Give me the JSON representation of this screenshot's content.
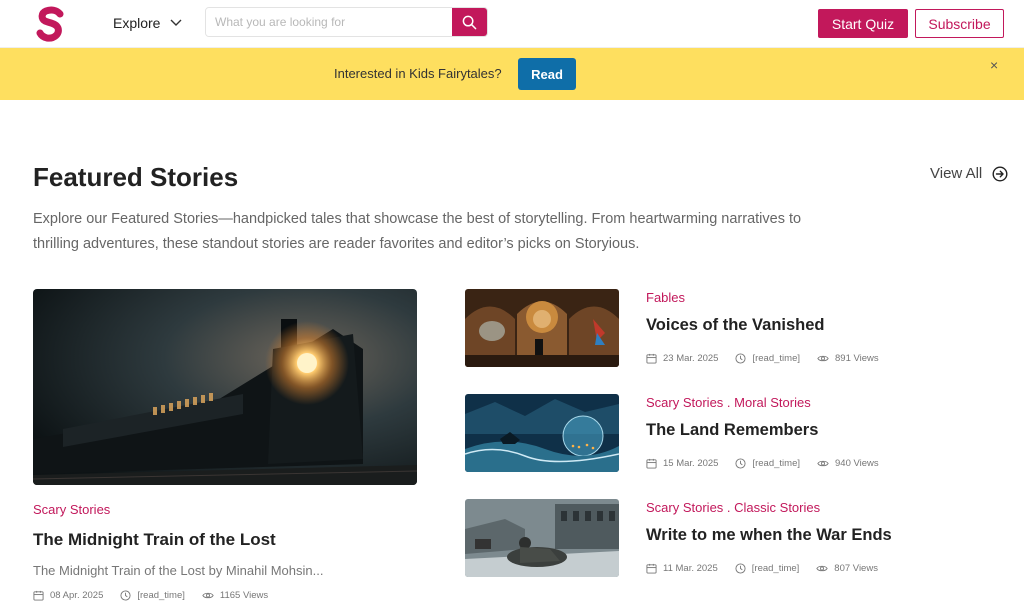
{
  "header": {
    "explore_label": "Explore",
    "search_placeholder": "What you are looking for",
    "start_quiz_label": "Start Quiz",
    "subscribe_label": "Subscribe",
    "accent_color": "#c2185b"
  },
  "banner": {
    "text": "Interested in Kids Fairytales?",
    "button_label": "Read",
    "close_label": "×",
    "background_color": "#fedf5f"
  },
  "featured": {
    "title": "Featured Stories",
    "view_all_label": "View All",
    "description": "Explore our Featured Stories—handpicked tales that showcase the best of storytelling. From heartwarming narratives to thrilling adventures, these standout stories are reader favorites and editor’s picks on Storyious.",
    "main_story": {
      "category": "Scary Stories",
      "title": "The Midnight Train of the Lost",
      "excerpt": "The Midnight Train of the Lost by Minahil Mohsin...",
      "date": "08 Apr. 2025",
      "read_time": "[read_time]",
      "views": "1165 Views"
    },
    "side_stories": [
      {
        "category": "Fables",
        "title": "Voices of the Vanished",
        "date": "23 Mar. 2025",
        "read_time": "[read_time]",
        "views": "891 Views"
      },
      {
        "category": "Scary Stories . Moral Stories",
        "title": "The Land Remembers",
        "date": "15 Mar. 2025",
        "read_time": "[read_time]",
        "views": "940 Views"
      },
      {
        "category": "Scary Stories . Classic Stories",
        "title": "Write to me when the War Ends",
        "date": "11 Mar. 2025",
        "read_time": "[read_time]",
        "views": "807 Views"
      }
    ]
  },
  "icons": [
    "logo-s-icon",
    "chevron-down-icon",
    "search-icon",
    "close-icon",
    "arrow-circle-right-icon",
    "calendar-icon",
    "clock-icon",
    "eye-icon"
  ]
}
